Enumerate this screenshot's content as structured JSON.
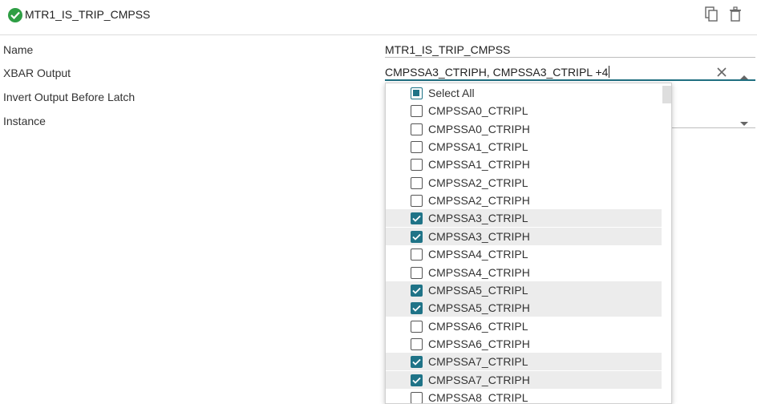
{
  "header": {
    "title": "MTR1_IS_TRIP_CMPSS",
    "status_icon": "check-circle-icon",
    "status_color": "#2e9e44"
  },
  "fields": {
    "name_label": "Name",
    "name_value": "MTR1_IS_TRIP_CMPSS",
    "xbar_label": "XBAR Output",
    "xbar_value": "CMPSSA3_CTRIPH, CMPSSA3_CTRIPL +4",
    "invert_label": "Invert Output Before Latch",
    "instance_label": "Instance"
  },
  "dropdown": {
    "accent_color": "#1f7387",
    "options": [
      {
        "label": "Select All",
        "state": "partial"
      },
      {
        "label": "CMPSSA0_CTRIPL",
        "state": "unchecked"
      },
      {
        "label": "CMPSSA0_CTRIPH",
        "state": "unchecked"
      },
      {
        "label": "CMPSSA1_CTRIPL",
        "state": "unchecked"
      },
      {
        "label": "CMPSSA1_CTRIPH",
        "state": "unchecked"
      },
      {
        "label": "CMPSSA2_CTRIPL",
        "state": "unchecked"
      },
      {
        "label": "CMPSSA2_CTRIPH",
        "state": "unchecked"
      },
      {
        "label": "CMPSSA3_CTRIPL",
        "state": "checked"
      },
      {
        "label": "CMPSSA3_CTRIPH",
        "state": "checked"
      },
      {
        "label": "CMPSSA4_CTRIPL",
        "state": "unchecked"
      },
      {
        "label": "CMPSSA4_CTRIPH",
        "state": "unchecked"
      },
      {
        "label": "CMPSSA5_CTRIPL",
        "state": "checked"
      },
      {
        "label": "CMPSSA5_CTRIPH",
        "state": "checked"
      },
      {
        "label": "CMPSSA6_CTRIPL",
        "state": "unchecked"
      },
      {
        "label": "CMPSSA6_CTRIPH",
        "state": "unchecked"
      },
      {
        "label": "CMPSSA7_CTRIPL",
        "state": "checked"
      },
      {
        "label": "CMPSSA7_CTRIPH",
        "state": "checked"
      },
      {
        "label": "CMPSSA8_CTRIPL",
        "state": "unchecked"
      }
    ]
  }
}
